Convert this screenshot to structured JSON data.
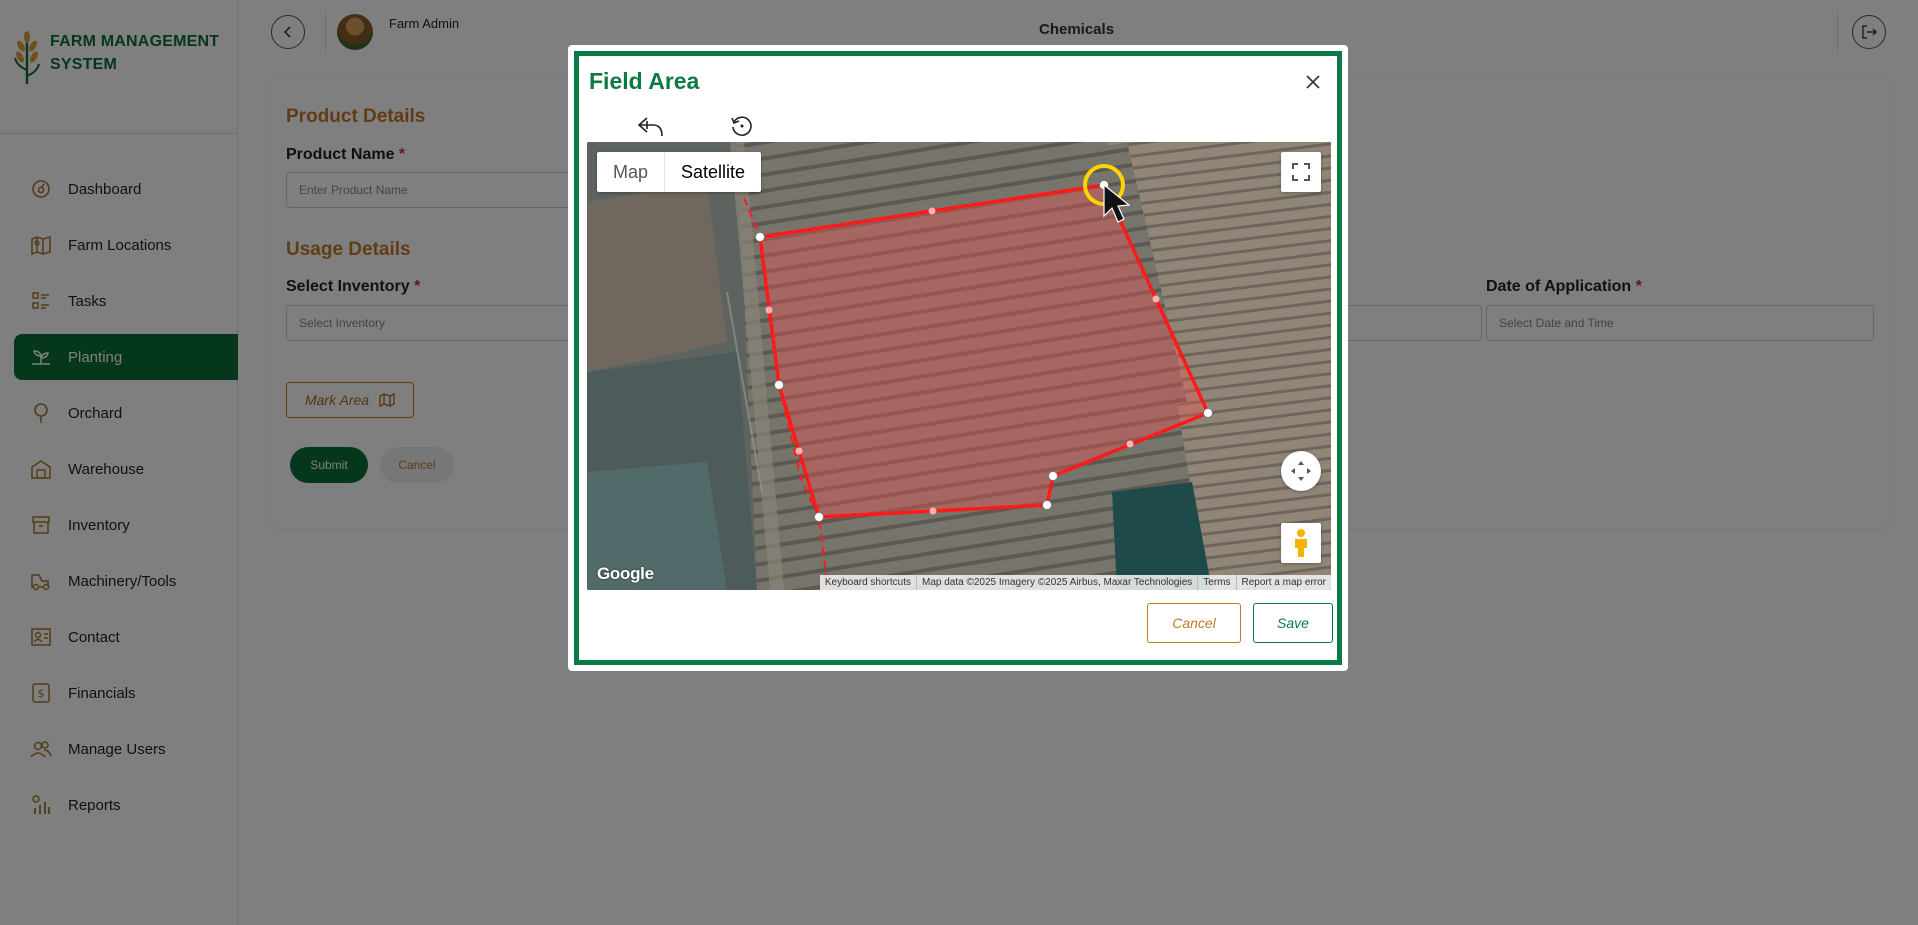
{
  "brand": {
    "line1": "FARM MANAGEMENT",
    "line2": "SYSTEM"
  },
  "sidebar": {
    "items": [
      {
        "label": "Dashboard",
        "icon": "dashboard-icon"
      },
      {
        "label": "Farm Locations",
        "icon": "map-pin-icon"
      },
      {
        "label": "Tasks",
        "icon": "tasks-icon"
      },
      {
        "label": "Planting",
        "icon": "plant-icon",
        "active": true
      },
      {
        "label": "Orchard",
        "icon": "tree-icon"
      },
      {
        "label": "Warehouse",
        "icon": "warehouse-icon"
      },
      {
        "label": "Inventory",
        "icon": "inventory-icon"
      },
      {
        "label": "Machinery/Tools",
        "icon": "tools-icon"
      },
      {
        "label": "Contact",
        "icon": "contact-icon"
      },
      {
        "label": "Financials",
        "icon": "financials-icon"
      },
      {
        "label": "Manage Users",
        "icon": "users-icon"
      },
      {
        "label": "Reports",
        "icon": "reports-icon"
      }
    ]
  },
  "header": {
    "user_name": "Farm Admin",
    "page_title": "Chemicals"
  },
  "form": {
    "product_section": "Product Details",
    "product_name_label": "Product Name",
    "product_name_placeholder": "Enter Product Name",
    "usage_section": "Usage Details",
    "inventory_label": "Select Inventory",
    "inventory_placeholder": "Select Inventory",
    "date_label": "Date of Application",
    "date_placeholder": "Select Date and Time",
    "required_mark": "*",
    "mark_area": "Mark Area",
    "submit": "Submit",
    "cancel": "Cancel"
  },
  "modal": {
    "title": "Field Area",
    "map_type_map": "Map",
    "map_type_satellite": "Satellite",
    "map_type_selected": "Satellite",
    "google_logo": "Google",
    "attribution": {
      "shortcuts": "Keyboard shortcuts",
      "data": "Map data ©2025 Imagery ©2025 Airbus, Maxar Technologies",
      "terms": "Terms",
      "report": "Report a map error"
    },
    "cancel": "Cancel",
    "save": "Save"
  },
  "colors": {
    "brand_green": "#0b6e3a",
    "accent_orange": "#c07b2a",
    "polygon_stroke": "#ff1a1a",
    "polygon_fill": "rgba(255,80,80,0.35)",
    "cursor_highlight": "#ffd200"
  }
}
